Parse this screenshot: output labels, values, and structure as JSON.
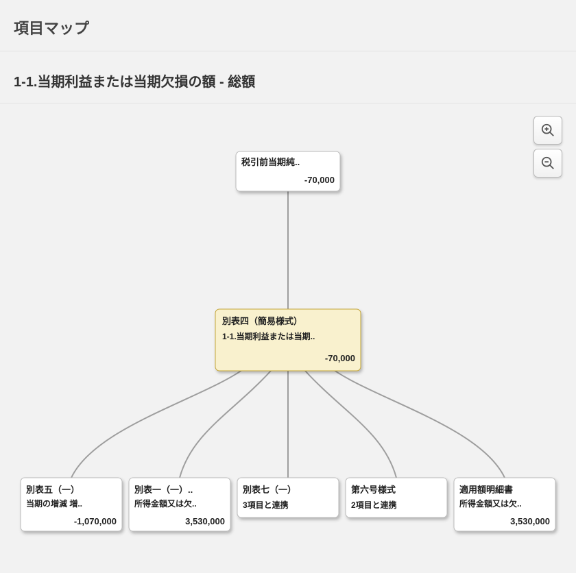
{
  "header": {
    "title": "項目マップ"
  },
  "subheader": {
    "title": "1-1.当期利益または当期欠損の額 - 総額"
  },
  "zoom": {
    "in_label": "zoom in",
    "out_label": "zoom out"
  },
  "nodes": {
    "root": {
      "line1": "税引前当期純..",
      "value": "-70,000"
    },
    "center": {
      "line1": "別表四（簡易様式）",
      "line2": "1-1.当期利益または当期..",
      "value": "-70,000"
    },
    "c1": {
      "line1": "別表五（一）",
      "line2": "当期の増減 増..",
      "value": "-1,070,000"
    },
    "c2": {
      "line1": "別表一（一）..",
      "line2": "所得金額又は欠..",
      "value": "3,530,000"
    },
    "c3": {
      "line1": "別表七（一）",
      "line2": "3項目と連携",
      "value": ""
    },
    "c4": {
      "line1": "第六号様式",
      "line2": "2項目と連携",
      "value": ""
    },
    "c5": {
      "line1": "適用額明細書",
      "line2": "所得金額又は欠..",
      "value": "3,530,000"
    }
  }
}
